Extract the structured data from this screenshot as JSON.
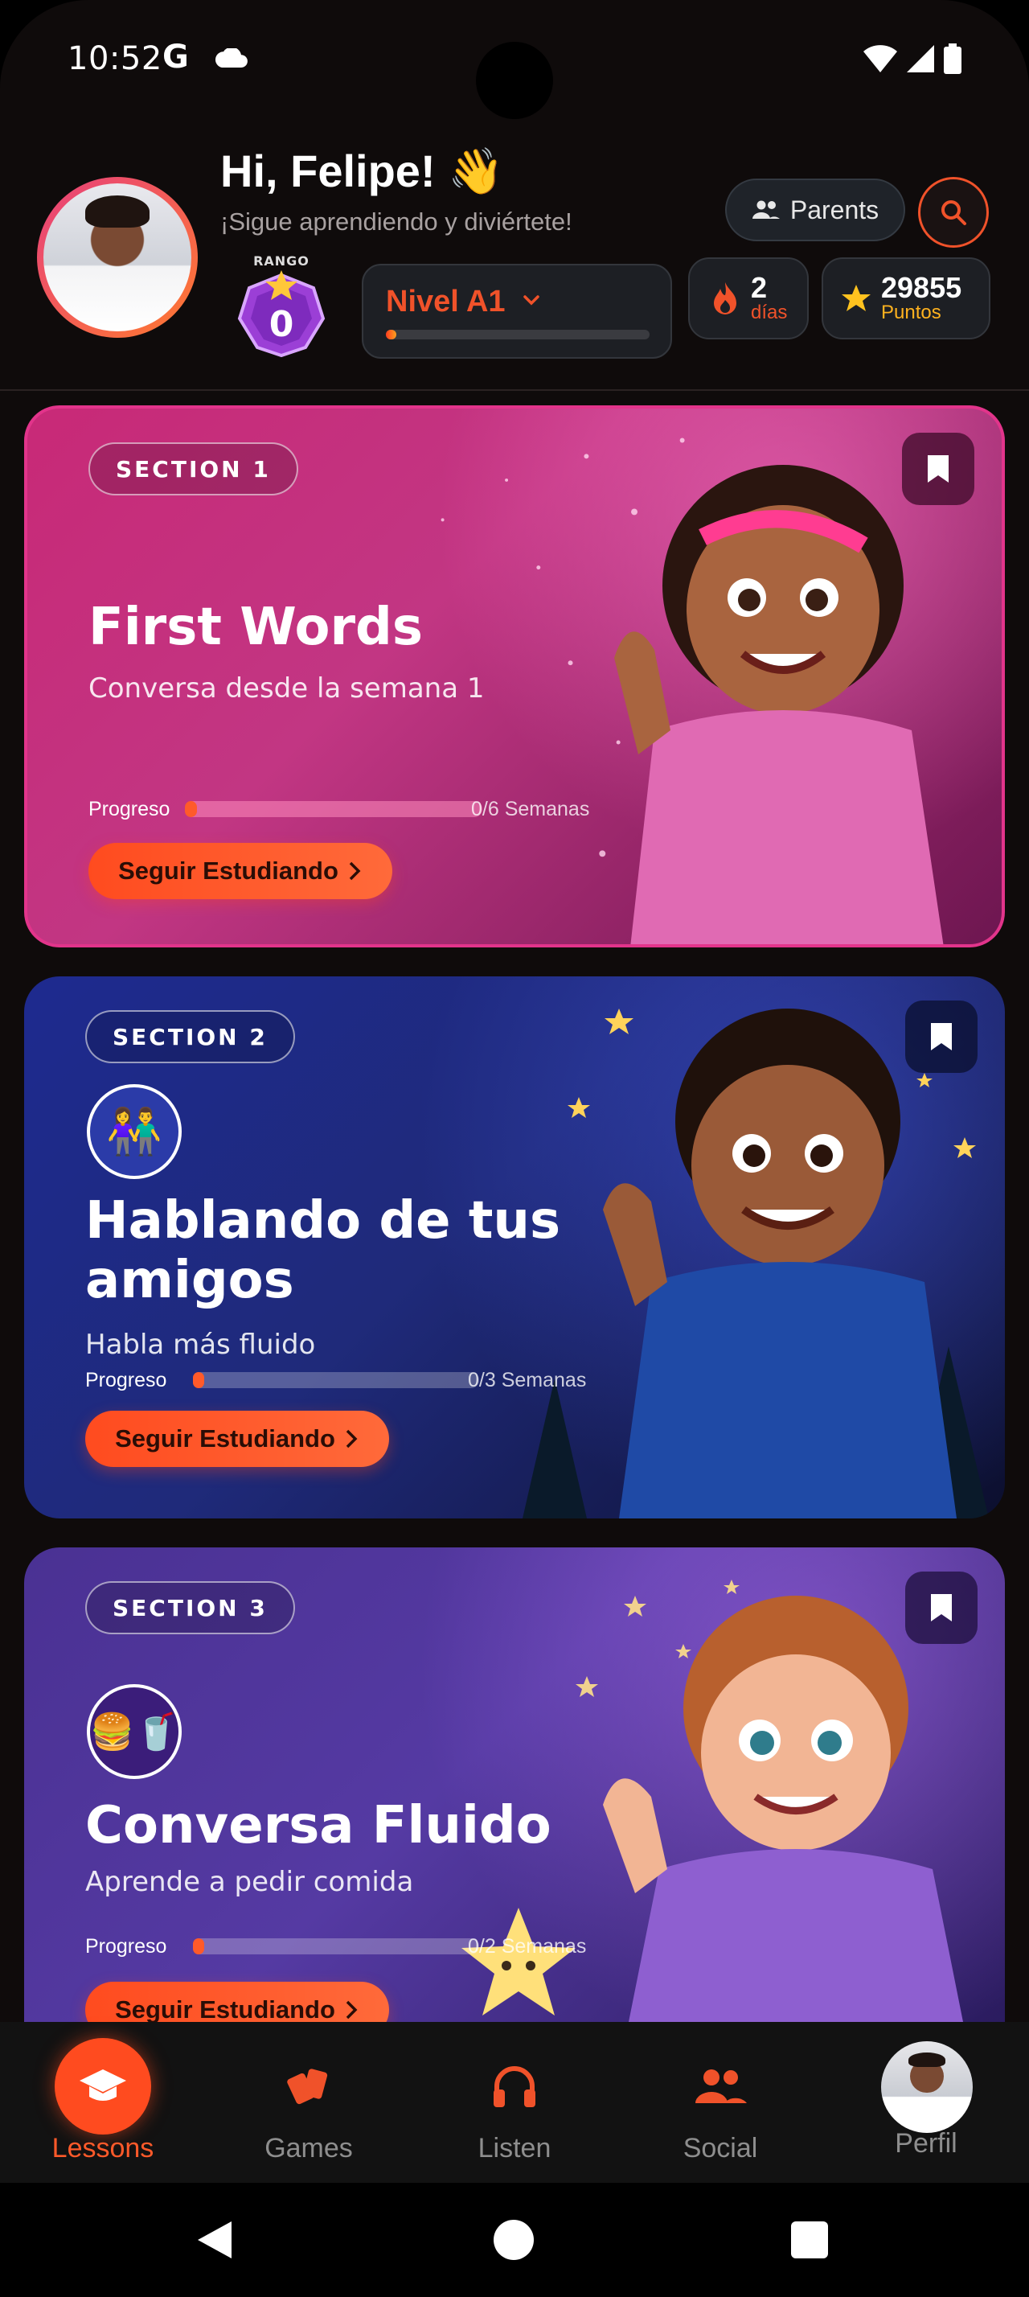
{
  "status_bar": {
    "time": "10:52",
    "g_glyph": "G"
  },
  "header": {
    "greeting": "Hi, Felipe! 👋",
    "subtitle": "¡Sigue aprendiendo y diviértete!",
    "parents_label": "Parents",
    "rank_label": "RANGO",
    "rank_value": "0",
    "level_label": "Nivel A1",
    "level_progress": 0.04,
    "streak_value": "2",
    "streak_label": "días",
    "points_value": "29855",
    "points_label": "Puntos"
  },
  "sections": [
    {
      "pill": "SECTION 1",
      "title": "First Words",
      "subtitle": "Conversa desde la semana 1",
      "progress_label": "Progreso",
      "progress_text": "0/6 Semanas",
      "progress": 0.0,
      "cta": "Seguir Estudiando"
    },
    {
      "pill": "SECTION 2",
      "title": "Hablando de tus amigos",
      "subtitle": "Habla más fluido",
      "progress_label": "Progreso",
      "progress_text": "0/3 Semanas",
      "progress": 0.0,
      "cta": "Seguir Estudiando",
      "topic_emoji": "👫"
    },
    {
      "pill": "SECTION 3",
      "title": "Conversa Fluido",
      "subtitle": "Aprende a pedir comida",
      "progress_label": "Progreso",
      "progress_text": "0/2 Semanas",
      "progress": 0.0,
      "cta": "Seguir Estudiando",
      "topic_emoji": "🍔🥤"
    }
  ],
  "bottom_nav": [
    {
      "label": "Lessons",
      "icon": "graduation-cap-icon",
      "active": true
    },
    {
      "label": "Games",
      "icon": "cards-icon",
      "active": false
    },
    {
      "label": "Listen",
      "icon": "headphones-icon",
      "active": false
    },
    {
      "label": "Social",
      "icon": "people-icon",
      "active": false
    },
    {
      "label": "Perfil",
      "icon": "avatar",
      "active": false
    }
  ],
  "colors": {
    "accent": "#ff4b1f",
    "background": "#0f0b0b",
    "card1": "#c82977",
    "card2": "#1e2a8f",
    "card3": "#4a3193",
    "points": "#ffb21f"
  }
}
